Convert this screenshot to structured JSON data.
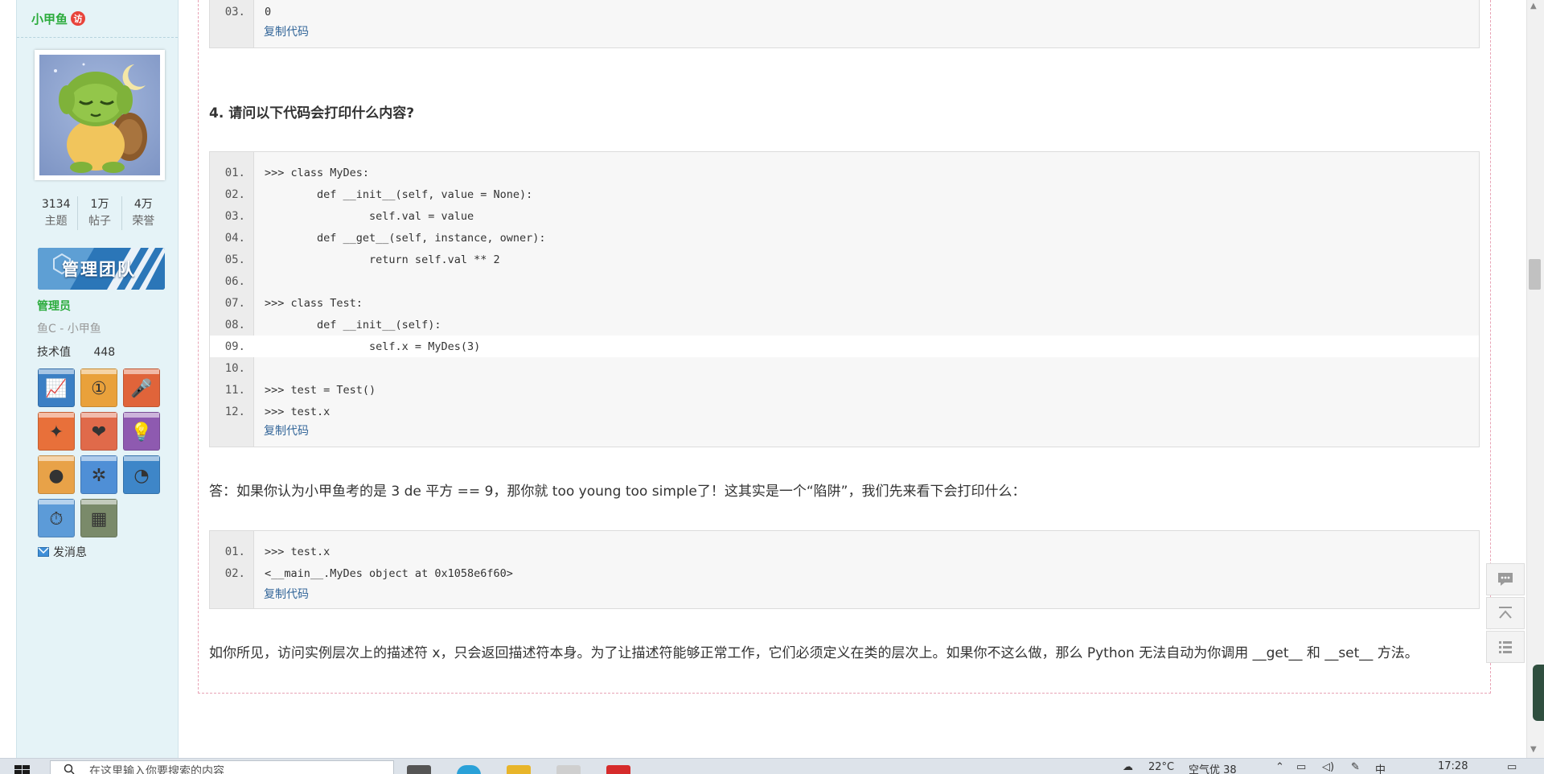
{
  "user": {
    "name": "小甲鱼",
    "badge": "访",
    "stats": [
      {
        "num": "3134",
        "label": "主题"
      },
      {
        "num": "1万",
        "label": "帖子"
      },
      {
        "num": "4万",
        "label": "荣誉"
      }
    ],
    "group_banner": "管理团队",
    "group": "管理员",
    "title": "鱼C - 小甲鱼",
    "tech_label": "技术值",
    "tech_value": "448",
    "send_message": "发消息",
    "medals": [
      {
        "icon": "chart-medal-icon",
        "color": "#3b7fc4",
        "glyph": "📈"
      },
      {
        "icon": "first-place-medal-icon",
        "color": "#e9a13b",
        "glyph": "①"
      },
      {
        "icon": "microphone-medal-icon",
        "color": "#e0643a",
        "glyph": "🎤"
      },
      {
        "icon": "star-medal-icon",
        "color": "#e8703a",
        "glyph": "✦"
      },
      {
        "icon": "heart-medal-icon",
        "color": "#e06a4a",
        "glyph": "❤"
      },
      {
        "icon": "lightbulb-medal-icon",
        "color": "#8e5ab0",
        "glyph": "💡"
      },
      {
        "icon": "egg-medal-icon",
        "color": "#e8a248",
        "glyph": "●"
      },
      {
        "icon": "gear-medal-icon",
        "color": "#4f8fd6",
        "glyph": "✲"
      },
      {
        "icon": "clock-medal-icon",
        "color": "#3e86c8",
        "glyph": "◔"
      },
      {
        "icon": "stopwatch-medal-icon",
        "color": "#5c9bd8",
        "glyph": "⏱"
      },
      {
        "icon": "photo-medal-icon",
        "color": "#7a8a6a",
        "glyph": "▦"
      }
    ]
  },
  "post": {
    "block1": {
      "lines": [
        {
          "ln": "03.",
          "code": "0"
        }
      ]
    },
    "copy_label": "复制代码",
    "question": "4. 请问以下代码会打印什么内容?",
    "block2": {
      "lines": [
        {
          "ln": "01.",
          "code": ">>> class MyDes:"
        },
        {
          "ln": "02.",
          "code": "        def __init__(self, value = None):"
        },
        {
          "ln": "03.",
          "code": "                self.val = value"
        },
        {
          "ln": "04.",
          "code": "        def __get__(self, instance, owner):"
        },
        {
          "ln": "05.",
          "code": "                return self.val ** 2"
        },
        {
          "ln": "06.",
          "code": ""
        },
        {
          "ln": "07.",
          "code": ">>> class Test:"
        },
        {
          "ln": "08.",
          "code": "        def __init__(self):"
        },
        {
          "ln": "09.",
          "code": "                self.x = MyDes(3)"
        },
        {
          "ln": "10.",
          "code": ""
        },
        {
          "ln": "11.",
          "code": ">>> test = Test()"
        },
        {
          "ln": "12.",
          "code": ">>> test.x"
        }
      ]
    },
    "answer": "答：如果你认为小甲鱼考的是 3 de 平方 == 9，那你就 too young too simple了！这其实是一个“陷阱”，我们先来看下会打印什么：",
    "block3": {
      "lines": [
        {
          "ln": "01.",
          "code": ">>> test.x"
        },
        {
          "ln": "02.",
          "code": "<__main__.MyDes object at 0x1058e6f60>"
        }
      ]
    },
    "explanation": "如你所见，访问实例层次上的描述符 x，只会返回描述符本身。为了让描述符能够正常工作，它们必须定义在类的层次上。如果你不这么做，那么 Python 无法自动为你调用 __get__ 和 __set__ 方法。"
  },
  "taskbar": {
    "search_placeholder": "在这里输入你要搜索的内容",
    "weather": "22°C",
    "weather_note": "空气优 38",
    "time": "17:28"
  },
  "colors": {
    "sidebar_bg": "#e5f3f7",
    "username": "#2bab3c",
    "link": "#336699",
    "post_border": "#e8a3b5"
  }
}
